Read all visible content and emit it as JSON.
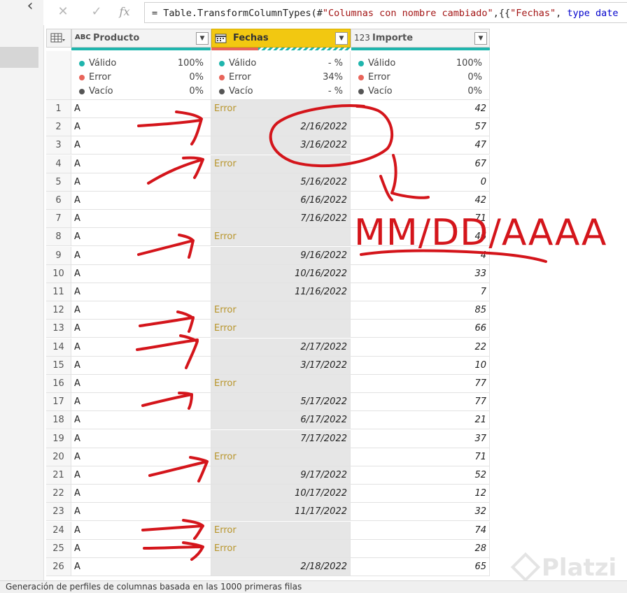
{
  "formula_bar": {
    "cancel_icon": "close-icon",
    "commit_icon": "check-icon",
    "fx_label": "fx",
    "formula_prefix": "= Table.TransformColumnTypes(#",
    "formula_str1": "\"Columnas con nombre cambiado\"",
    "formula_mid": ",{{",
    "formula_str2": "\"Fechas\"",
    "formula_mid2": ", ",
    "formula_kw": "type date"
  },
  "columns": [
    {
      "type_icon": "ABC",
      "name": "Producto"
    },
    {
      "type_icon": "calendar-icon",
      "name": "Fechas"
    },
    {
      "type_icon": "123",
      "name": "Importe"
    }
  ],
  "quality": {
    "labels": [
      "Válido",
      "Error",
      "Vacío"
    ],
    "producto": [
      "100%",
      "0%",
      "0%"
    ],
    "fechas": [
      "- %",
      "34%",
      "- %"
    ],
    "importe": [
      "100%",
      "0%",
      "0%"
    ],
    "fechas_error_fraction": 0.34
  },
  "rows": [
    {
      "n": "1",
      "p": "A",
      "f": "Error",
      "i": "42"
    },
    {
      "n": "2",
      "p": "A",
      "f": "2/16/2022",
      "i": "57"
    },
    {
      "n": "3",
      "p": "A",
      "f": "3/16/2022",
      "i": "47"
    },
    {
      "n": "4",
      "p": "A",
      "f": "Error",
      "i": "67"
    },
    {
      "n": "5",
      "p": "A",
      "f": "5/16/2022",
      "i": "0"
    },
    {
      "n": "6",
      "p": "A",
      "f": "6/16/2022",
      "i": "42"
    },
    {
      "n": "7",
      "p": "A",
      "f": "7/16/2022",
      "i": "71"
    },
    {
      "n": "8",
      "p": "A",
      "f": "Error",
      "i": "46"
    },
    {
      "n": "9",
      "p": "A",
      "f": "9/16/2022",
      "i": "4"
    },
    {
      "n": "10",
      "p": "A",
      "f": "10/16/2022",
      "i": "33"
    },
    {
      "n": "11",
      "p": "A",
      "f": "11/16/2022",
      "i": "7"
    },
    {
      "n": "12",
      "p": "A",
      "f": "Error",
      "i": "85"
    },
    {
      "n": "13",
      "p": "A",
      "f": "Error",
      "i": "66"
    },
    {
      "n": "14",
      "p": "A",
      "f": "2/17/2022",
      "i": "22"
    },
    {
      "n": "15",
      "p": "A",
      "f": "3/17/2022",
      "i": "10"
    },
    {
      "n": "16",
      "p": "A",
      "f": "Error",
      "i": "77"
    },
    {
      "n": "17",
      "p": "A",
      "f": "5/17/2022",
      "i": "77"
    },
    {
      "n": "18",
      "p": "A",
      "f": "6/17/2022",
      "i": "21"
    },
    {
      "n": "19",
      "p": "A",
      "f": "7/17/2022",
      "i": "37"
    },
    {
      "n": "20",
      "p": "A",
      "f": "Error",
      "i": "71"
    },
    {
      "n": "21",
      "p": "A",
      "f": "9/17/2022",
      "i": "52"
    },
    {
      "n": "22",
      "p": "A",
      "f": "10/17/2022",
      "i": "12"
    },
    {
      "n": "23",
      "p": "A",
      "f": "11/17/2022",
      "i": "32"
    },
    {
      "n": "24",
      "p": "A",
      "f": "Error",
      "i": "74"
    },
    {
      "n": "25",
      "p": "A",
      "f": "Error",
      "i": "28"
    },
    {
      "n": "26",
      "p": "A",
      "f": "2/18/2022",
      "i": "65"
    }
  ],
  "annotation_text": "MM/DD/AAAA",
  "annotation_color": "#d4151b",
  "status_text": "Generación de perfiles de columnas basada en las 1000 primeras filas",
  "watermark": "Platzi",
  "colors": {
    "valid": "#1fb5ad",
    "error": "#e8645a",
    "empty": "#555555",
    "selected_header": "#f2c811",
    "error_text": "#b8952b"
  }
}
